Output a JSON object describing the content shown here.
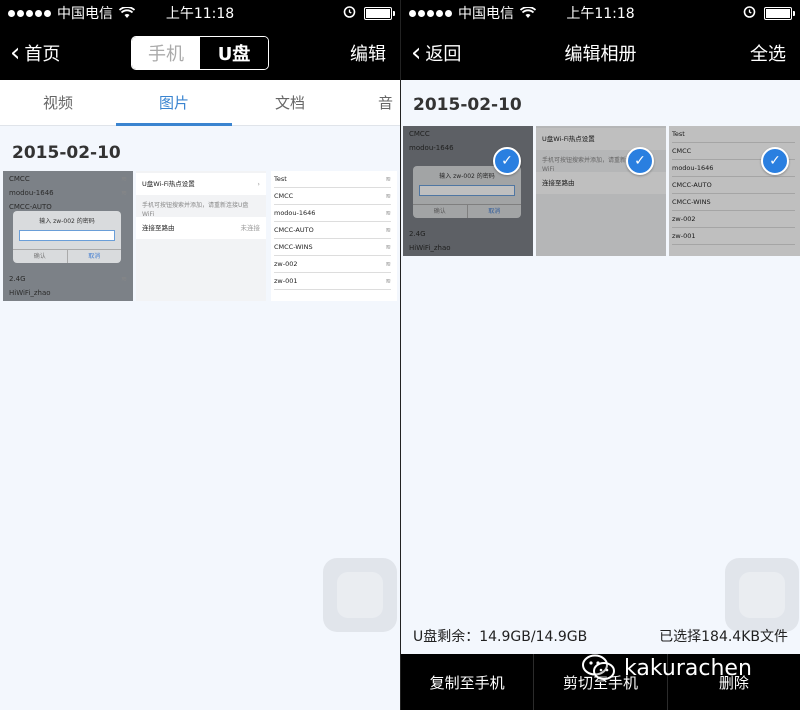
{
  "status": {
    "carrier": "中国电信",
    "time": "上午11:18"
  },
  "left": {
    "nav": {
      "back": "首页",
      "seg_phone": "手机",
      "seg_udisk": "U盘",
      "edit": "编辑"
    },
    "tabs": [
      "视频",
      "图片",
      "文档",
      "音"
    ],
    "date": "2015-02-10"
  },
  "right": {
    "nav": {
      "back": "返回",
      "title": "编辑相册",
      "select_all": "全选"
    },
    "date": "2015-02-10",
    "storage_left": "U盘剩余：14.9GB/14.9GB",
    "storage_right": "已选择184.4KB文件",
    "actions": [
      "复制至手机",
      "剪切至手机",
      "删除"
    ]
  },
  "thumbs": {
    "wifi_dialog": {
      "rows": [
        "CMCC",
        "modou-1646",
        "CMCC-AUTO",
        "2.4G",
        "HiWiFi_zhao"
      ],
      "title": "输入 zw-002 的密码",
      "cancel": "取消",
      "confirm": "确认"
    },
    "hotspot": {
      "item1": "U盘Wi-Fi热点设置",
      "note": "手机可按钮搜索并添加，请重新连接U盘WiFi",
      "item2": "连接至路由",
      "item2_sub": "未连接"
    },
    "network_list": [
      "Test",
      "CMCC",
      "modou-1646",
      "CMCC-AUTO",
      "CMCC-WINS",
      "zw-002",
      "zw-001"
    ]
  },
  "watermark": "kakurachen"
}
